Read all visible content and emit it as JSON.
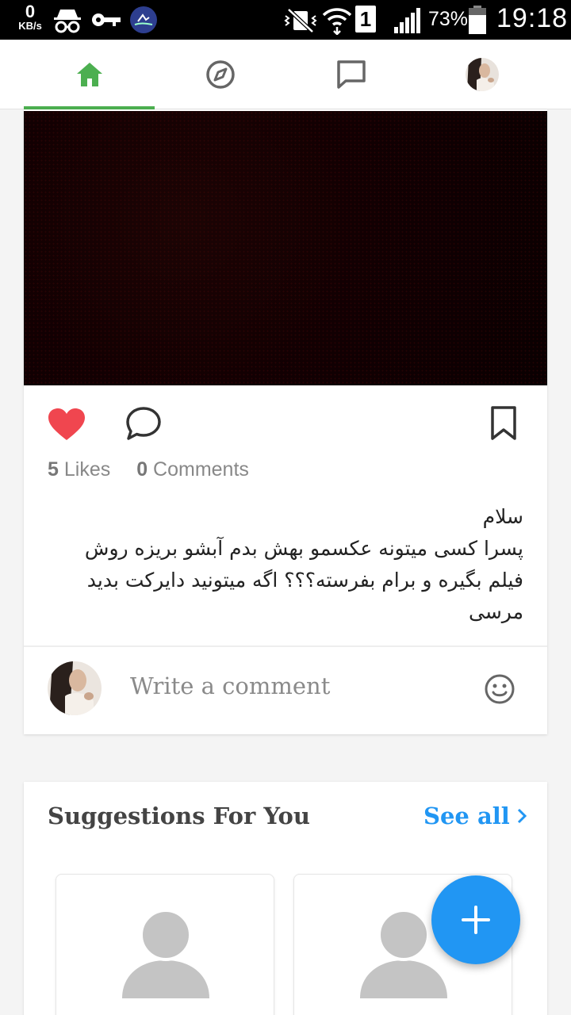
{
  "status_bar": {
    "net_speed_value": "0",
    "net_speed_unit": "KB/s",
    "sim_slot": "1",
    "battery_percent": "73%",
    "time": "19:18"
  },
  "nav": {
    "tabs": [
      "home",
      "explore",
      "messages",
      "profile"
    ],
    "active_tab": "home",
    "active_color": "#4caf50"
  },
  "post": {
    "liked": true,
    "likes_count": "5",
    "likes_label": "Likes",
    "comments_count": "0",
    "comments_label": "Comments",
    "caption": "سلام\nپسرا کسی میتونه عکسمو بهش بدم آبشو بریزه روش فیلم بگیره و برام بفرسته؟؟؟ اگه میتونید دایرکت بدید\nمرسی",
    "comment_placeholder": "Write a comment"
  },
  "suggestions": {
    "title": "Suggestions For You",
    "see_all": "See all"
  },
  "colors": {
    "heart": "#f0464f",
    "link": "#2196f3",
    "fab": "#2196f3"
  }
}
